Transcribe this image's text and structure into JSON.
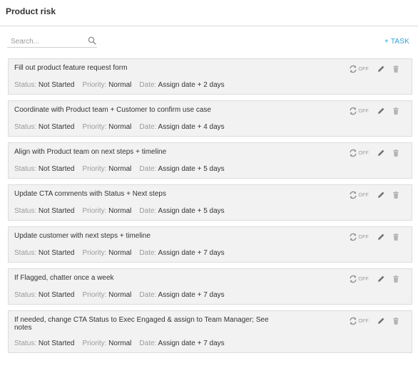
{
  "page": {
    "title": "Product risk"
  },
  "search": {
    "placeholder": "Search..."
  },
  "toolbar": {
    "add_task_label": "+ TASK"
  },
  "labels": {
    "status": "Status:",
    "priority": "Priority:",
    "date": "Date:",
    "sync_off": "OFF"
  },
  "colors": {
    "accent": "#2aa3d8",
    "card_bg": "#f2f2f2",
    "label_gray": "#999999"
  },
  "tasks": [
    {
      "title": "Fill out product feature request form",
      "status": "Not Started",
      "priority": "Normal",
      "date": "Assign date + 2 days"
    },
    {
      "title": "Coordinate with Product team + Customer to confirm use case",
      "status": "Not Started",
      "priority": "Normal",
      "date": "Assign date + 4 days"
    },
    {
      "title": "Align with Product team on next steps + timeline",
      "status": "Not Started",
      "priority": "Normal",
      "date": "Assign date + 5 days"
    },
    {
      "title": "Update CTA comments with Status + Next steps",
      "status": "Not Started",
      "priority": "Normal",
      "date": "Assign date + 5 days"
    },
    {
      "title": "Update customer with next steps + timeline",
      "status": "Not Started",
      "priority": "Normal",
      "date": "Assign date + 7 days"
    },
    {
      "title": "If Flagged, chatter once a week",
      "status": "Not Started",
      "priority": "Normal",
      "date": "Assign date + 7 days"
    },
    {
      "title": "If needed, change CTA Status to Exec Engaged & assign to Team Manager; See notes",
      "status": "Not Started",
      "priority": "Normal",
      "date": "Assign date + 7 days"
    }
  ],
  "icons": {
    "search": "search-icon",
    "sync": "sync-icon",
    "edit": "pencil-icon",
    "delete": "trash-icon"
  }
}
